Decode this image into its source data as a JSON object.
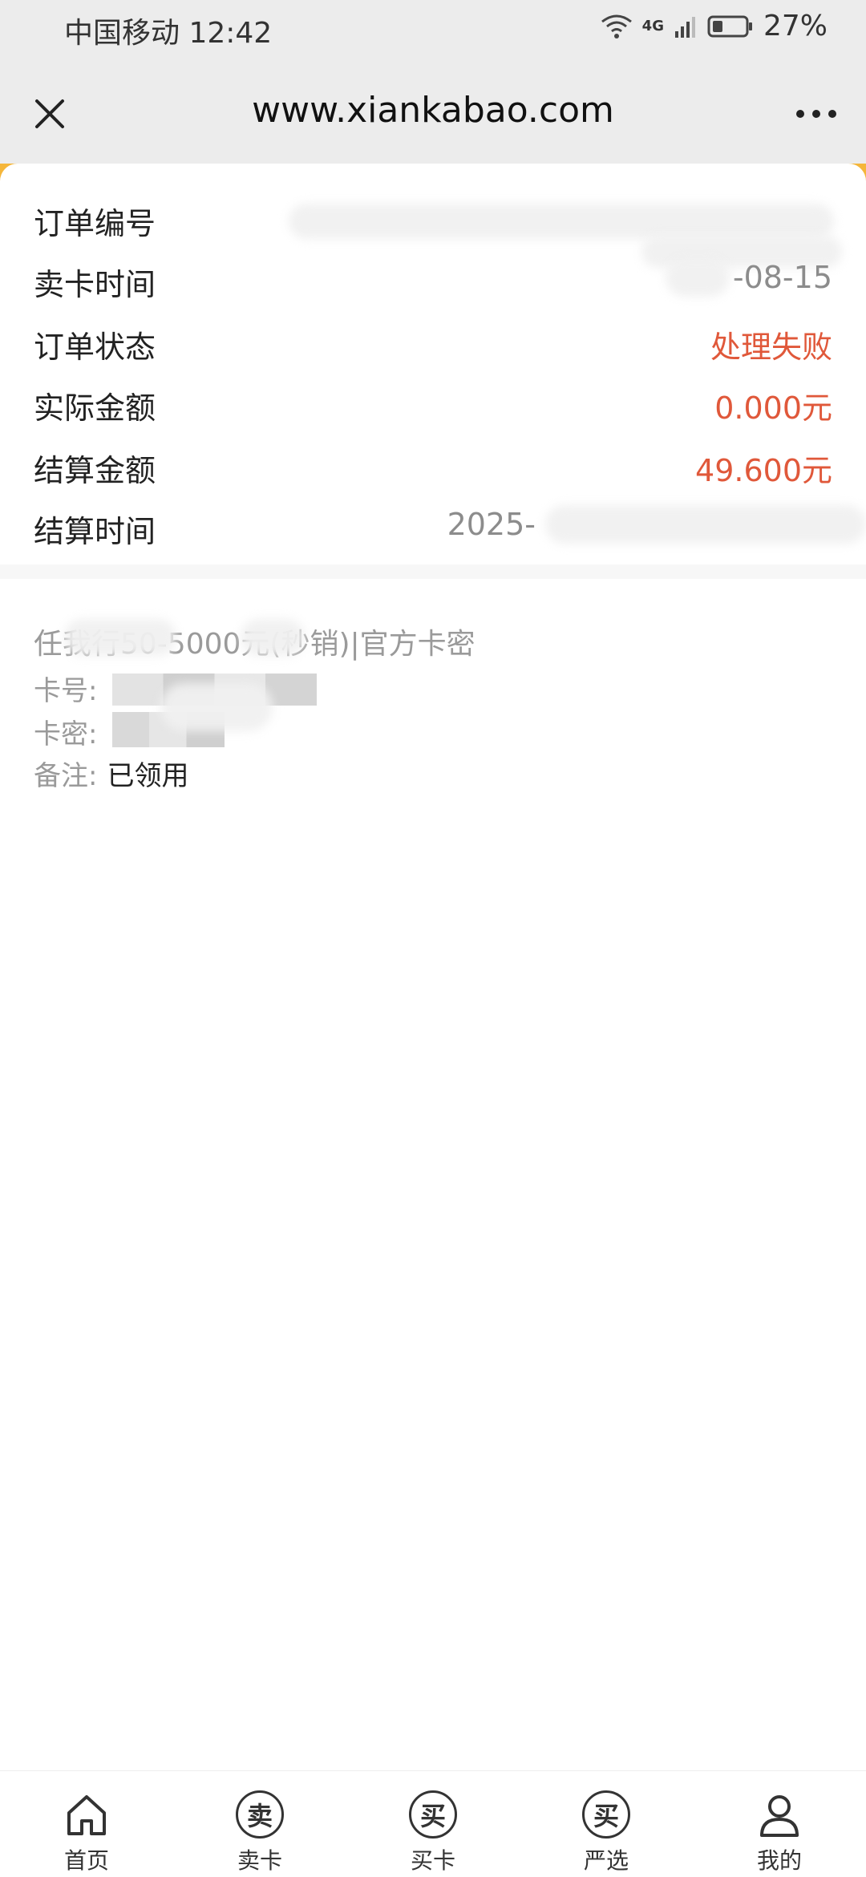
{
  "status_bar": {
    "carrier": "中国移动",
    "time": "12:42",
    "network": "4G",
    "battery_pct": "27%"
  },
  "browser": {
    "url": "www.xiankabao.com"
  },
  "order": {
    "rows": [
      {
        "label": "订单编号",
        "value": ""
      },
      {
        "label": "卖卡时间",
        "value": "-08-15"
      },
      {
        "label": "订单状态",
        "value": "处理失败"
      },
      {
        "label": "实际金额",
        "value": "0.000元"
      },
      {
        "label": "结算金额",
        "value": "49.600元"
      },
      {
        "label": "结算时间",
        "value": "2025-"
      }
    ]
  },
  "card_info": {
    "title": "任我行50-5000元(秒销)|官方卡密",
    "card_no_label": "卡号:",
    "card_pwd_label": "卡密:",
    "remark_label": "备注:",
    "remark_value": "已领用"
  },
  "bottom_nav": {
    "items": [
      {
        "label": "首页"
      },
      {
        "label": "卖卡",
        "glyph": "卖"
      },
      {
        "label": "买卡",
        "glyph": "买"
      },
      {
        "label": "严选",
        "glyph": "买"
      },
      {
        "label": "我的"
      }
    ]
  },
  "colors": {
    "accent": "#f5b63a",
    "status_red": "#e0583a"
  }
}
